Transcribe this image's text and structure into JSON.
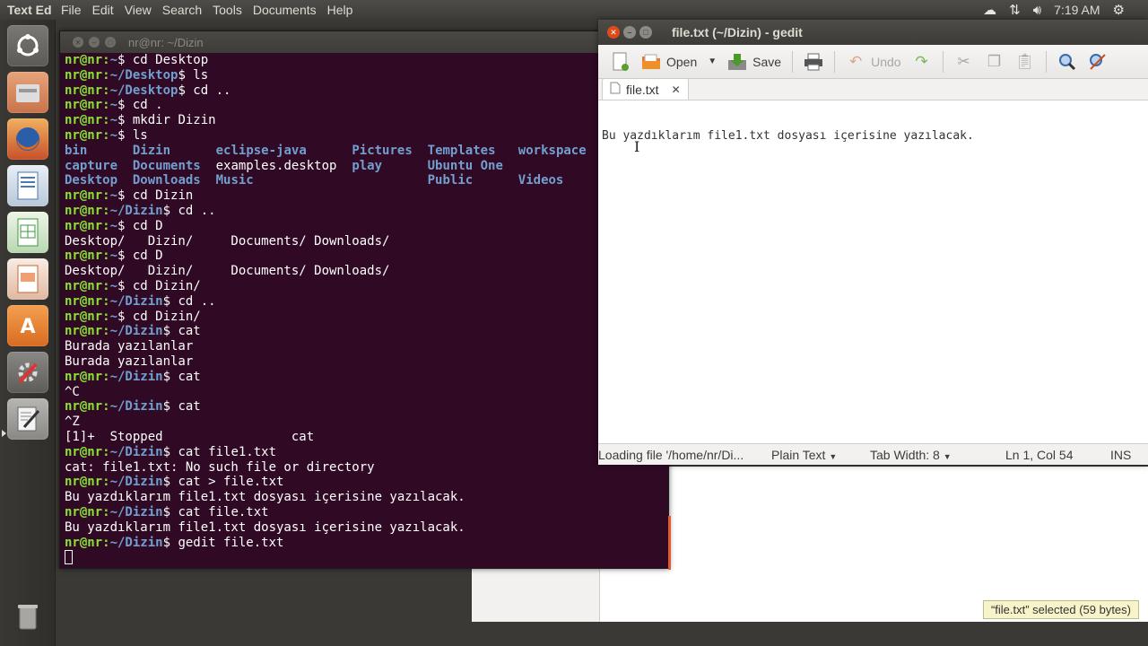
{
  "top_panel": {
    "app_title": "Text Ed",
    "menu": [
      "File",
      "Edit",
      "View",
      "Search",
      "Tools",
      "Documents",
      "Help"
    ],
    "tray_icons": [
      "cloud-icon",
      "network-arrows-icon",
      "volume-icon"
    ],
    "clock": "7:19 AM"
  },
  "launcher": {
    "items": [
      "dash-home-icon",
      "file-manager-icon",
      "firefox-icon",
      "writer-icon",
      "calc-icon",
      "impress-icon",
      "software-center-icon",
      "system-settings-icon",
      "text-editor-icon",
      "trash-icon"
    ]
  },
  "terminal": {
    "title": "nr@nr: ~/Dizin",
    "prompt_user": "nr@nr",
    "lines": [
      {
        "kind": "cmd",
        "path": "~",
        "cmd": "cd Desktop"
      },
      {
        "kind": "cmd",
        "path": "~/Desktop",
        "cmd": "ls"
      },
      {
        "kind": "cmd",
        "path": "~/Desktop",
        "cmd": "cd .."
      },
      {
        "kind": "cmd",
        "path": "~",
        "cmd": "cd ."
      },
      {
        "kind": "cmd",
        "path": "~",
        "cmd": "mkdir Dizin"
      },
      {
        "kind": "cmd",
        "path": "~",
        "cmd": "ls"
      },
      {
        "kind": "ls",
        "cols": [
          [
            "bin",
            "dir"
          ],
          [
            "Dizin",
            "dir"
          ],
          [
            "eclipse-java",
            "dir"
          ],
          [
            "Pictures",
            "dir"
          ],
          [
            "Templates",
            "dir"
          ],
          [
            "workspace",
            "dir"
          ]
        ]
      },
      {
        "kind": "ls",
        "cols": [
          [
            "capture",
            "dir"
          ],
          [
            "Documents",
            "dir"
          ],
          [
            "examples.desktop",
            "file"
          ],
          [
            "play",
            "dir"
          ],
          [
            "Ubuntu One",
            "dir"
          ]
        ]
      },
      {
        "kind": "ls",
        "cols": [
          [
            "Desktop",
            "dir"
          ],
          [
            "Downloads",
            "dir"
          ],
          [
            "Music",
            "dir"
          ],
          [
            "",
            "file"
          ],
          [
            "Public",
            "dir"
          ],
          [
            "Videos",
            "dir"
          ]
        ]
      },
      {
        "kind": "cmd",
        "path": "~",
        "cmd": "cd Dizin"
      },
      {
        "kind": "cmd",
        "path": "~/Dizin",
        "cmd": "cd .."
      },
      {
        "kind": "cmd",
        "path": "~",
        "cmd": "cd D"
      },
      {
        "kind": "out",
        "text": "Desktop/   Dizin/     Documents/ Downloads/"
      },
      {
        "kind": "cmd",
        "path": "~",
        "cmd": "cd D"
      },
      {
        "kind": "out",
        "text": "Desktop/   Dizin/     Documents/ Downloads/"
      },
      {
        "kind": "cmd",
        "path": "~",
        "cmd": "cd Dizin/"
      },
      {
        "kind": "cmd",
        "path": "~/Dizin",
        "cmd": "cd .."
      },
      {
        "kind": "cmd",
        "path": "~",
        "cmd": "cd Dizin/"
      },
      {
        "kind": "cmd",
        "path": "~/Dizin",
        "cmd": "cat"
      },
      {
        "kind": "out",
        "text": "Burada yazılanlar"
      },
      {
        "kind": "out",
        "text": "Burada yazılanlar"
      },
      {
        "kind": "cmd",
        "path": "~/Dizin",
        "cmd": "cat"
      },
      {
        "kind": "out",
        "text": "^C"
      },
      {
        "kind": "cmd",
        "path": "~/Dizin",
        "cmd": "cat"
      },
      {
        "kind": "out",
        "text": "^Z"
      },
      {
        "kind": "out",
        "text": "[1]+  Stopped                 cat"
      },
      {
        "kind": "cmd",
        "path": "~/Dizin",
        "cmd": "cat file1.txt"
      },
      {
        "kind": "out",
        "text": "cat: file1.txt: No such file or directory"
      },
      {
        "kind": "cmd",
        "path": "~/Dizin",
        "cmd": "cat > file.txt"
      },
      {
        "kind": "out",
        "text": "Bu yazdıklarım file1.txt dosyası içerisine yazılacak."
      },
      {
        "kind": "cmd",
        "path": "~/Dizin",
        "cmd": "cat file.txt"
      },
      {
        "kind": "out",
        "text": "Bu yazdıklarım file1.txt dosyası içerisine yazılacak."
      },
      {
        "kind": "cmd",
        "path": "~/Dizin",
        "cmd": "gedit file.txt"
      },
      {
        "kind": "cursor"
      }
    ]
  },
  "gedit": {
    "title": "file.txt (~/Dizin) - gedit",
    "toolbar": {
      "open_label": "Open",
      "save_label": "Save",
      "undo_label": "Undo"
    },
    "tab_label": "file.txt",
    "content": "Bu yazdıklarım file1.txt dosyası içerisine yazılacak.",
    "status": {
      "loading": "Loading file '/home/nr/Di...",
      "language": "Plain Text",
      "tab_width": "Tab Width:  8",
      "position": "Ln 1, Col 54",
      "mode": "INS"
    }
  },
  "file_manager": {
    "selection_status": "“file.txt” selected  (59 bytes)"
  }
}
